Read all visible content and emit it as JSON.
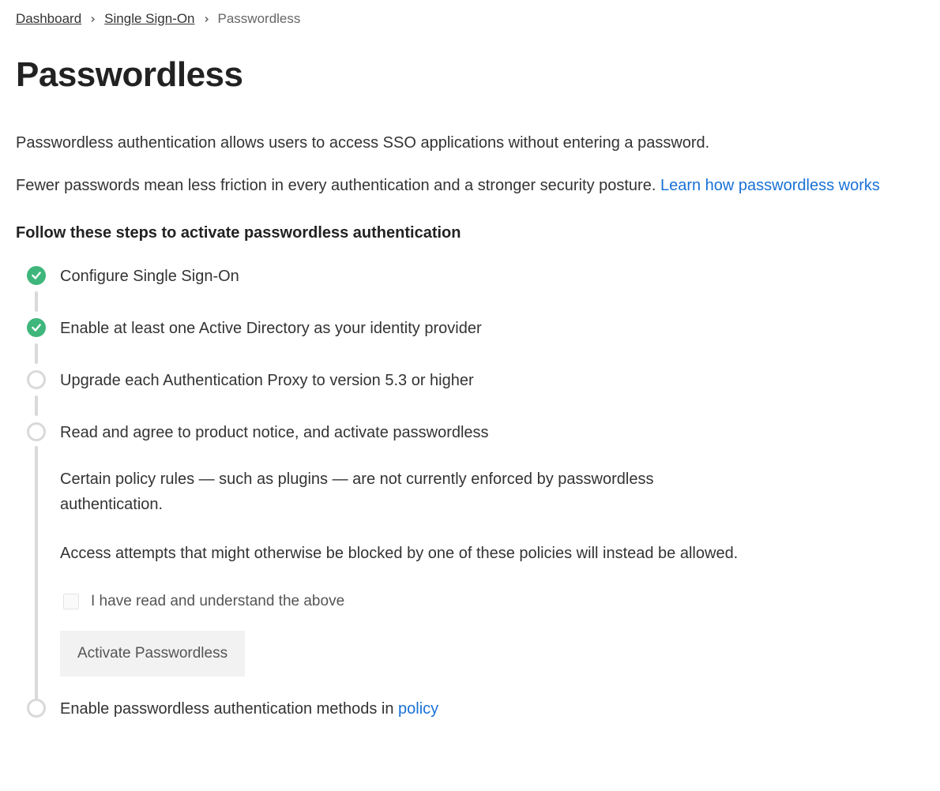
{
  "breadcrumb": {
    "items": [
      {
        "label": "Dashboard",
        "link": true
      },
      {
        "label": "Single Sign-On",
        "link": true
      },
      {
        "label": "Passwordless",
        "link": false
      }
    ]
  },
  "page": {
    "title": "Passwordless",
    "intro_line1": "Passwordless authentication allows users to access SSO applications without entering a password.",
    "intro_line2_text": "Fewer passwords mean less friction in every authentication and a stronger security posture. ",
    "intro_line2_link": "Learn how passwordless works",
    "steps_heading": "Follow these steps to activate passwordless authentication"
  },
  "steps": [
    {
      "title": "Configure Single Sign-On",
      "done": true
    },
    {
      "title": "Enable at least one Active Directory as your identity provider",
      "done": true
    },
    {
      "title": "Upgrade each Authentication Proxy to version 5.3 or higher",
      "done": false
    },
    {
      "title": "Read and agree to product notice, and activate passwordless",
      "done": false,
      "body_p1": "Certain policy rules — such as plugins — are not currently enforced by passwordless authentication.",
      "body_p2": "Access attempts that might otherwise be blocked by one of these policies will instead be allowed.",
      "ack_label": "I have read and understand the above",
      "button_label": "Activate Passwordless"
    },
    {
      "title_prefix": "Enable passwordless authentication methods in ",
      "title_link": "policy",
      "done": false
    }
  ]
}
